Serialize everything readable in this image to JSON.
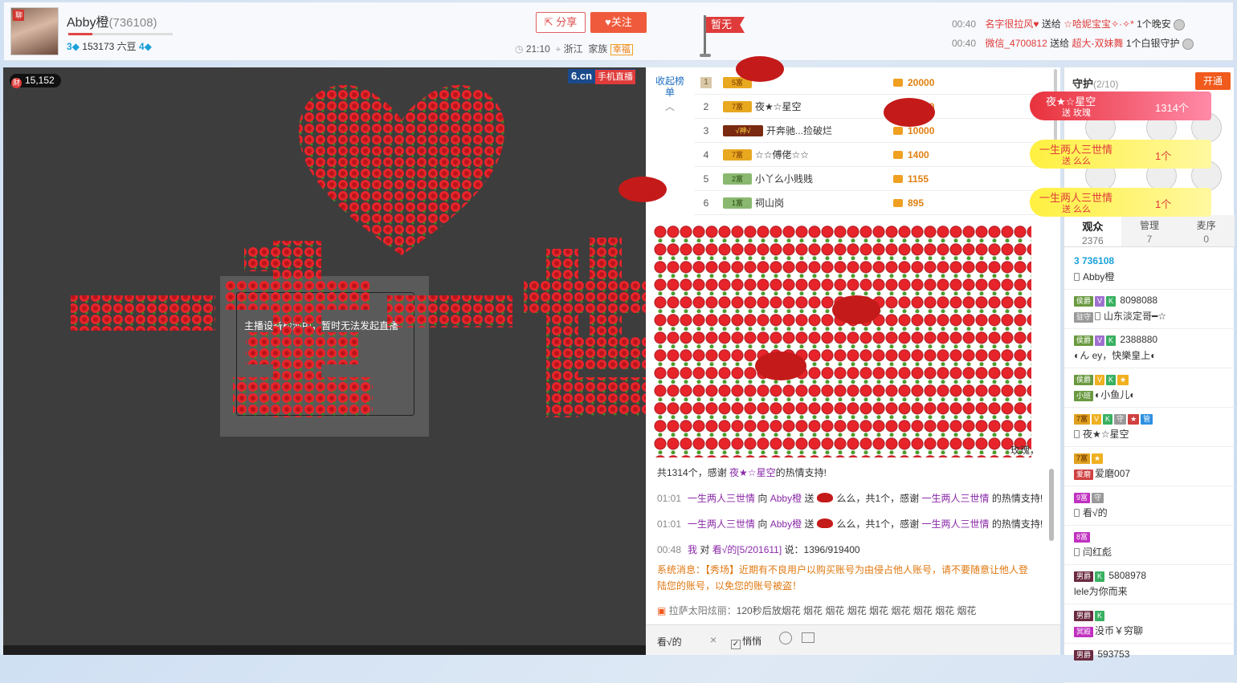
{
  "header": {
    "anchor_name": "Abby橙",
    "room_id": "(736108)",
    "level_left": "3",
    "beans": "153173 六豆",
    "level_right": "4",
    "share_label": "分享",
    "follow_label": "关注",
    "time": "21:10",
    "location": "浙江",
    "family_label": "家族",
    "family_name": "幸福",
    "flag_label": "暂无",
    "gifts": [
      {
        "time": "00:40",
        "from": "名字很拉风",
        "verb": "送给",
        "to": "☆哈妮宝宝✧·✧*",
        "what": "1个晚安"
      },
      {
        "time": "00:40",
        "from": "微信_4700812",
        "verb": "送给",
        "to": "超大-双妹舞",
        "what": "1个白银守护"
      }
    ]
  },
  "video": {
    "wealth": "15,152",
    "wealth_icon": "财",
    "logo": "6.cn",
    "logo_sub": "手机直播",
    "notice": "主播设备检测中，暂时无法发起直播",
    "overlay_text": "一生一世"
  },
  "rank": {
    "toggle_label": "收起榜单",
    "rows": [
      {
        "n": "1",
        "badge": "5富",
        "name": "",
        "value": "20000"
      },
      {
        "n": "2",
        "badge": "7富",
        "name": "夜★☆星空",
        "value": "10000"
      },
      {
        "n": "3",
        "badge": "√神√",
        "name": "开奔驰...捡破烂",
        "value": "10000"
      },
      {
        "n": "4",
        "badge": "7富",
        "name": "☆☆傅佬☆☆",
        "value": "1400"
      },
      {
        "n": "5",
        "badge": "2富",
        "name": "小丫么小贱贱",
        "value": "1155"
      },
      {
        "n": "6",
        "badge": "1富",
        "name": "祠山岗",
        "value": "895"
      }
    ]
  },
  "chat": {
    "rose_msg_tail": "玫瑰，",
    "rose_msg_line2_a": "共1314个，感谢",
    "rose_msg_user": "夜★☆星空",
    "rose_msg_line2_b": "的热情支持!",
    "lines": [
      {
        "time": "01:01",
        "user": "一生两人三世情",
        "to": "向",
        "anchor": "Abby橙",
        "send": "送",
        "gift": "么么，共1个，感谢",
        "user2": "一生两人三世情",
        "end": "的热情支持!"
      },
      {
        "time": "01:01",
        "user": "一生两人三世情",
        "to": "向",
        "anchor": "Abby橙",
        "send": "送",
        "gift": "么么，共1个，感谢",
        "user2": "一生两人三世情",
        "end": "的热情支持!"
      }
    ],
    "private": {
      "time": "00:48",
      "me": "我",
      "to": "对",
      "user": "看√的[5/201611]",
      "said": "说：1396/919400"
    },
    "system_label": "系统消息：",
    "system_text": "【秀场】近期有不良用户以购买账号为由侵占他人账号，请不要随意让他人登陆您的账号，以免您的账号被盗！",
    "fireworks_user": "拉萨太阳炫丽：",
    "fireworks_text": "120秒后放烟花 烟花 烟花 烟花 烟花 烟花 烟花 烟花 烟花"
  },
  "input": {
    "value": "看√的",
    "close": "×",
    "whisper_label": "悄悄",
    "whisper_check": "✓"
  },
  "guard": {
    "title": "守护",
    "count": "(2/10)",
    "open_label": "开通"
  },
  "gift_pops": [
    {
      "who": "夜★☆星空",
      "action": "送 玫瑰",
      "count": "1314个"
    },
    {
      "who": "一生两人三世情",
      "action": "送 么么",
      "count": "1个"
    },
    {
      "who": "一生两人三世情",
      "action": "送 么么",
      "count": "1个"
    }
  ],
  "tabs": [
    {
      "label": "观众",
      "num": "2376"
    },
    {
      "label": "管理",
      "num": "7"
    },
    {
      "label": "麦序",
      "num": "0"
    }
  ],
  "audience": [
    {
      "tags": [],
      "id": "3 736108",
      "name": "Abby橙",
      "tag2": ""
    },
    {
      "tags": [
        "侯爵",
        "V",
        "K"
      ],
      "id": "8098088",
      "name": "山东淡定哥━☆",
      "tag2": "驻守"
    },
    {
      "tags": [
        "侯爵",
        "V",
        "K"
      ],
      "id": "2388880",
      "name": "◐ん ey，快樂皇上◐",
      "tag2": ""
    },
    {
      "tags": [
        "侯爵",
        "V",
        "K",
        "★"
      ],
      "id": "",
      "name": "◐小鱼儿◐",
      "tag2": "小班"
    },
    {
      "tags": [
        "7富",
        "V",
        "K",
        "守",
        "★",
        "管"
      ],
      "id": "",
      "name": "夜★☆星空",
      "tag2": ""
    },
    {
      "tags": [
        "7富",
        "★"
      ],
      "id": "",
      "name": "爱磨007",
      "tag2": "爱磨"
    },
    {
      "tags": [
        "9富",
        "守"
      ],
      "id": "",
      "name": "看√的",
      "tag2": ""
    },
    {
      "tags": [
        "8富"
      ],
      "id": "",
      "name": "闫红彪",
      "tag2": ""
    },
    {
      "tags": [
        "男爵",
        "K"
      ],
      "id": "5808978",
      "name": "lele为你而来",
      "tag2": ""
    },
    {
      "tags": [
        "男爵",
        "K"
      ],
      "id": "",
      "name": "没币￥穷聊",
      "tag2": "冥殿"
    },
    {
      "tags": [
        "男爵"
      ],
      "id": "593753",
      "name": "",
      "tag2": ""
    }
  ],
  "colors": {
    "accent": "#f05a3c",
    "rose": "#e8242b",
    "link": "#8a2aa8",
    "system": "#e07810"
  }
}
